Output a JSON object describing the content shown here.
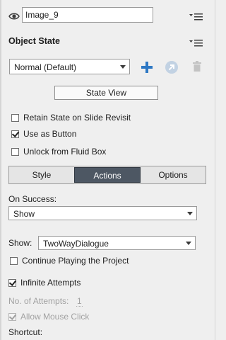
{
  "object": {
    "name": "Image_9"
  },
  "object_state": {
    "title": "Object State",
    "state_select": "Normal (Default)",
    "state_view_button": "State View"
  },
  "options": {
    "retain_state": {
      "label": "Retain State on Slide Revisit",
      "checked": false
    },
    "use_as_button": {
      "label": "Use as Button",
      "checked": true
    },
    "unlock_fluid_box": {
      "label": "Unlock from Fluid Box",
      "checked": false
    }
  },
  "tabs": [
    {
      "label": "Style",
      "active": false
    },
    {
      "label": "Actions",
      "active": true
    },
    {
      "label": "Options",
      "active": false
    }
  ],
  "actions": {
    "on_success_label": "On Success:",
    "on_success_value": "Show",
    "show_label": "Show:",
    "show_value": "TwoWayDialogue",
    "continue_playing": {
      "label": "Continue Playing the Project",
      "checked": false
    },
    "infinite_attempts": {
      "label": "Infinite Attempts",
      "checked": true
    },
    "attempts_label": "No. of Attempts:",
    "attempts_value": "1",
    "allow_mouse_click": {
      "label": "Allow Mouse Click",
      "checked": true,
      "disabled": true
    },
    "shortcut_label": "Shortcut:"
  },
  "colors": {
    "add_icon": "#2d78c4",
    "tab_active": "#4d5763"
  },
  "icons": [
    "eye-icon",
    "panel-menu-icon",
    "add-icon",
    "state-link-icon",
    "trash-icon"
  ]
}
